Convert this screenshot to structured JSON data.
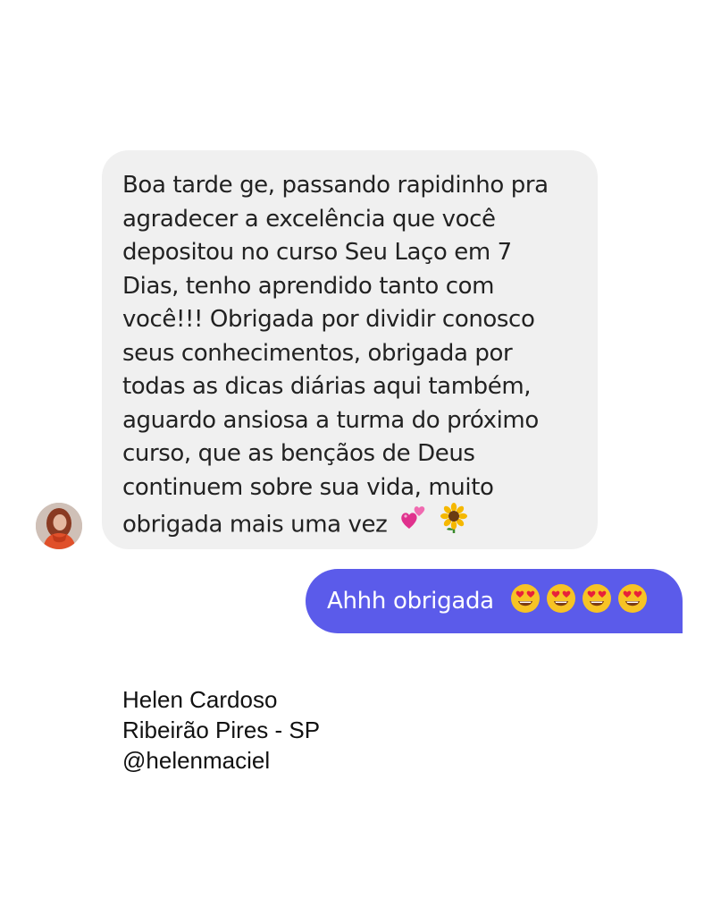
{
  "chat": {
    "incoming": {
      "lines": [
        "Boa tarde ge, passando rapidinho pra",
        "agradecer a excelência que você",
        "depositou no curso Seu Laço em 7",
        "Dias, tenho aprendido tanto com",
        "você!!! Obrigada por dividir conosco",
        "seus conhecimentos, obrigada por",
        "todas as dicas diárias aqui também,",
        "aguardo ansiosa a turma do próximo",
        "curso, que as bençãos de Deus",
        "continuem sobre sua vida, muito",
        "obrigada mais uma vez"
      ],
      "emojis": [
        "two-hearts-icon",
        "sunflower-icon"
      ],
      "bubble_color": "#f0f0f0",
      "sender_avatar": "avatar"
    },
    "outgoing": {
      "text": "Ahhh obrigada",
      "emojis": [
        "heart-eyes-icon",
        "heart-eyes-icon",
        "heart-eyes-icon",
        "heart-eyes-icon"
      ],
      "bubble_color": "#5b5bea"
    }
  },
  "signature": {
    "name": "Helen Cardoso",
    "location": "Ribeirão Pires - SP",
    "handle": "@helenmaciel"
  }
}
